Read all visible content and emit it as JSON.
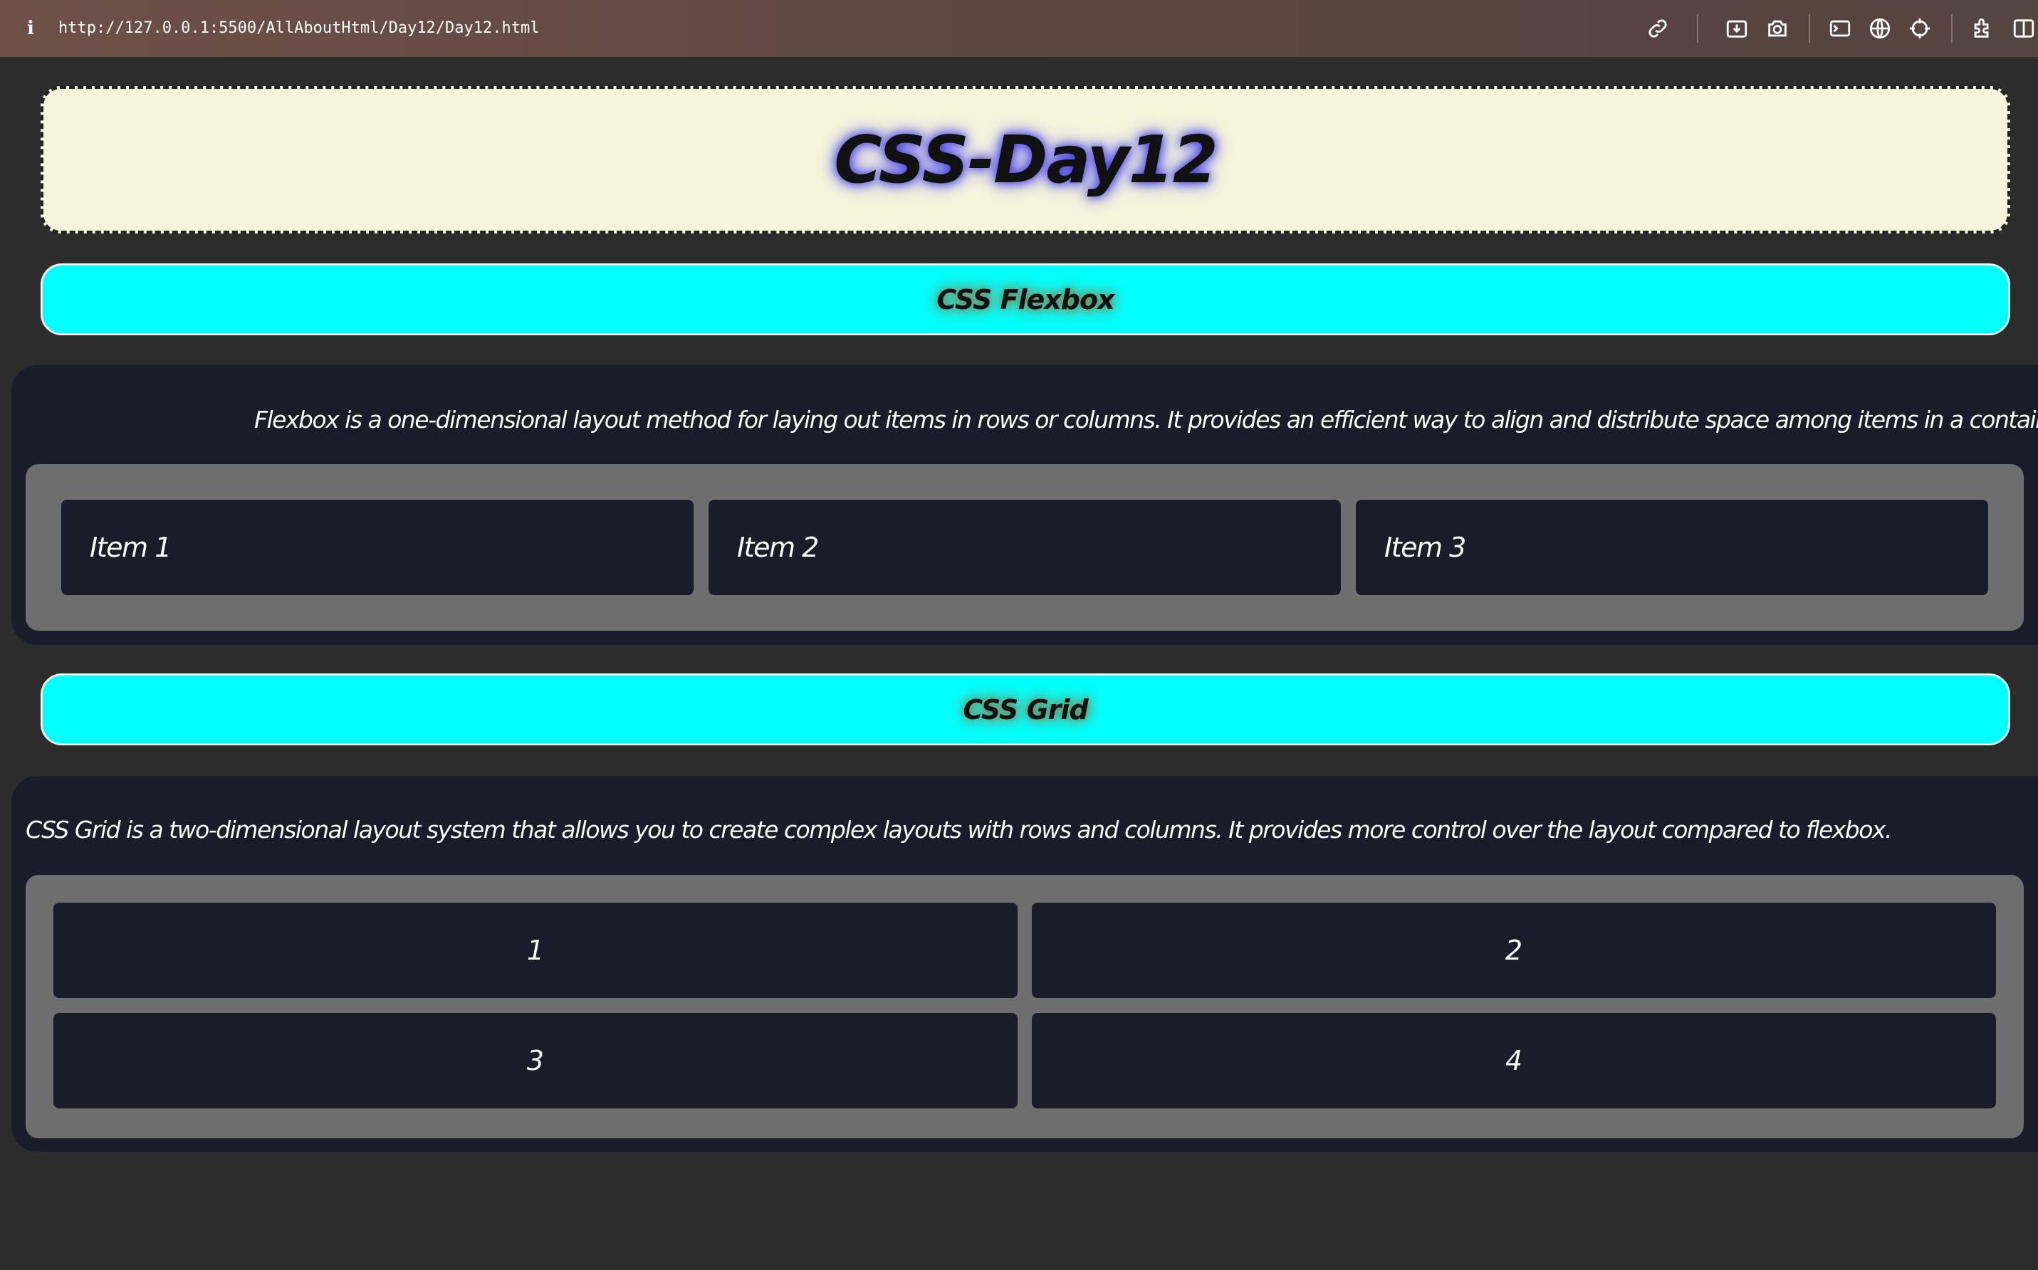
{
  "browser": {
    "url": "http://127.0.0.1:5500/AllAboutHtml/Day12/Day12.html",
    "info_icon": "i",
    "icons": [
      "link-icon",
      "download-icon",
      "camera-icon",
      "terminal-icon",
      "globe-icon",
      "crosshair-icon",
      "extensions-icon",
      "sidebar-icon"
    ]
  },
  "page": {
    "title": "CSS-Day12",
    "title_bg": "#f5f5dc",
    "accent": "#00ffff"
  },
  "flexbox": {
    "heading": "CSS Flexbox",
    "description": "Flexbox is a one-dimensional layout method for laying out items in rows or columns. It provides an efficient way to align and distribute space among items in a container.",
    "items": [
      {
        "label": "Item 1"
      },
      {
        "label": "Item 2"
      },
      {
        "label": "Item 3"
      }
    ]
  },
  "grid": {
    "heading": "CSS Grid",
    "description": "CSS Grid is a two-dimensional layout system that allows you to create complex layouts with rows and columns. It provides more control over the layout compared to flexbox.",
    "items": [
      {
        "label": "1"
      },
      {
        "label": "2"
      },
      {
        "label": "3"
      },
      {
        "label": "4"
      }
    ]
  }
}
